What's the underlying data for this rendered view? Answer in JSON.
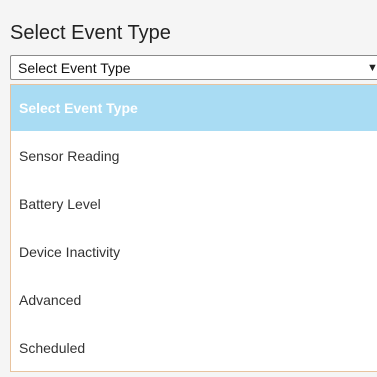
{
  "field": {
    "label": "Select Event Type"
  },
  "select": {
    "value": "Select Event Type",
    "arrow_icon": "triangle-down-icon"
  },
  "dropdown": {
    "options": [
      {
        "label": "Select Event Type",
        "selected": true
      },
      {
        "label": "Sensor Reading",
        "selected": false
      },
      {
        "label": "Battery Level",
        "selected": false
      },
      {
        "label": "Device Inactivity",
        "selected": false
      },
      {
        "label": "Advanced",
        "selected": false
      },
      {
        "label": "Scheduled",
        "selected": false
      }
    ]
  },
  "colors": {
    "highlight": "#a9dcf3",
    "list_border": "#e8c39e",
    "panel_background": "#f5f5f5"
  }
}
